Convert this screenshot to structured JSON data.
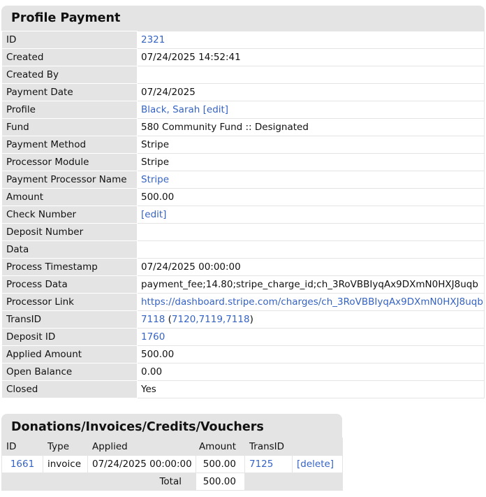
{
  "profile_payment": {
    "title": "Profile Payment",
    "rows": [
      {
        "label": "ID",
        "value": "2321",
        "link": true
      },
      {
        "label": "Created",
        "value": "07/24/2025 14:52:41"
      },
      {
        "label": "Created By",
        "value": ""
      },
      {
        "label": "Payment Date",
        "value": "07/24/2025"
      },
      {
        "label": "Profile",
        "value": "Black, Sarah [edit]",
        "link": true
      },
      {
        "label": "Fund",
        "value": "580 Community Fund :: Designated"
      },
      {
        "label": "Payment Method",
        "value": "Stripe"
      },
      {
        "label": "Processor Module",
        "value": "Stripe"
      },
      {
        "label": "Payment Processor Name",
        "value": "Stripe",
        "link": true
      },
      {
        "label": "Amount",
        "value": "500.00"
      },
      {
        "label": "Check Number",
        "value": "[edit]",
        "link": true
      },
      {
        "label": "Deposit Number",
        "value": ""
      },
      {
        "label": "Data",
        "value": ""
      },
      {
        "label": "Process Timestamp",
        "value": "07/24/2025 00:00:00"
      },
      {
        "label": "Process Data",
        "value": "payment_fee;14.80;stripe_charge_id;ch_3RoVBBIyqAx9DXmN0HXJ8uqb"
      },
      {
        "label": "Processor Link",
        "value": "https://dashboard.stripe.com/charges/ch_3RoVBBIyqAx9DXmN0HXJ8uqb",
        "link": true
      },
      {
        "label": "TransID",
        "value": "",
        "trans": {
          "main": "7118",
          "open": " (",
          "related": "7120,7119,7118",
          "close": ")"
        }
      },
      {
        "label": "Deposit ID",
        "value": "1760",
        "link": true
      },
      {
        "label": "Applied Amount",
        "value": "500.00"
      },
      {
        "label": "Open Balance",
        "value": "0.00"
      },
      {
        "label": "Closed",
        "value": "Yes"
      }
    ]
  },
  "donations": {
    "title": "Donations/Invoices/Credits/Vouchers",
    "headers": {
      "id": "ID",
      "type": "Type",
      "applied": "Applied",
      "amount": "Amount",
      "transid": "TransID"
    },
    "rows": [
      {
        "id": "1661",
        "type": "invoice",
        "applied": "07/24/2025 00:00:00",
        "amount": "500.00",
        "transid": "7125",
        "delete": "[delete]"
      }
    ],
    "total_label": "Total",
    "total_value": "500.00"
  }
}
